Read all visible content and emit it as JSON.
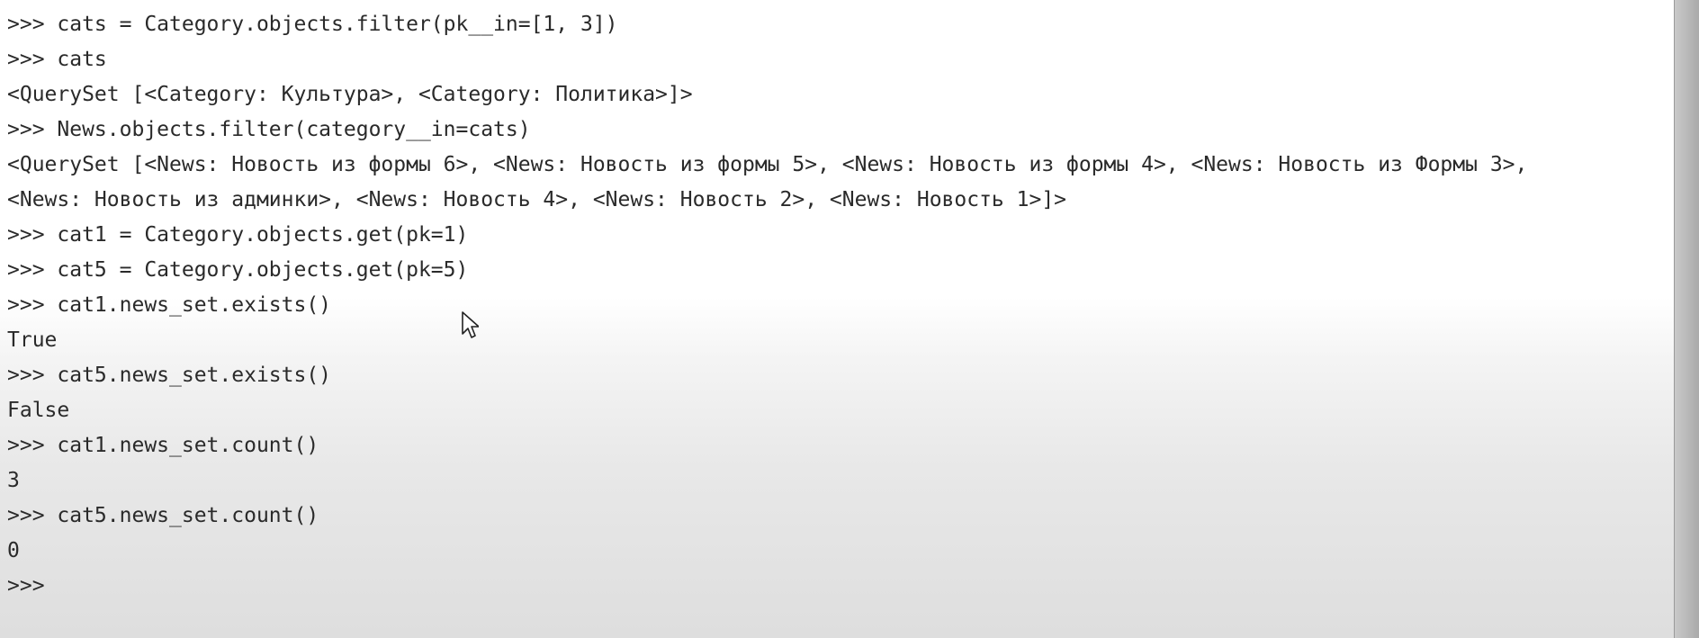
{
  "terminal": {
    "lines": [
      ">>> cats = Category.objects.filter(pk__in=[1, 3])",
      ">>> cats",
      "<QuerySet [<Category: Культура>, <Category: Политика>]>",
      ">>> News.objects.filter(category__in=cats)",
      "<QuerySet [<News: Новость из формы 6>, <News: Новость из формы 5>, <News: Новость из формы 4>, <News: Новость из Формы 3>,",
      "<News: Новость из админки>, <News: Новость 4>, <News: Новость 2>, <News: Новость 1>]>",
      ">>> cat1 = Category.objects.get(pk=1)",
      ">>> cat5 = Category.objects.get(pk=5)",
      ">>> cat1.news_set.exists()",
      "True",
      ">>> cat5.news_set.exists()",
      "False",
      ">>> cat1.news_set.count()",
      "3",
      ">>> cat5.news_set.count()",
      "0",
      ">>>"
    ]
  },
  "mouse_cursor": {
    "icon": "arrow-cursor-icon"
  },
  "colors": {
    "text": "#2a2a2a",
    "background": "#ffffff"
  }
}
